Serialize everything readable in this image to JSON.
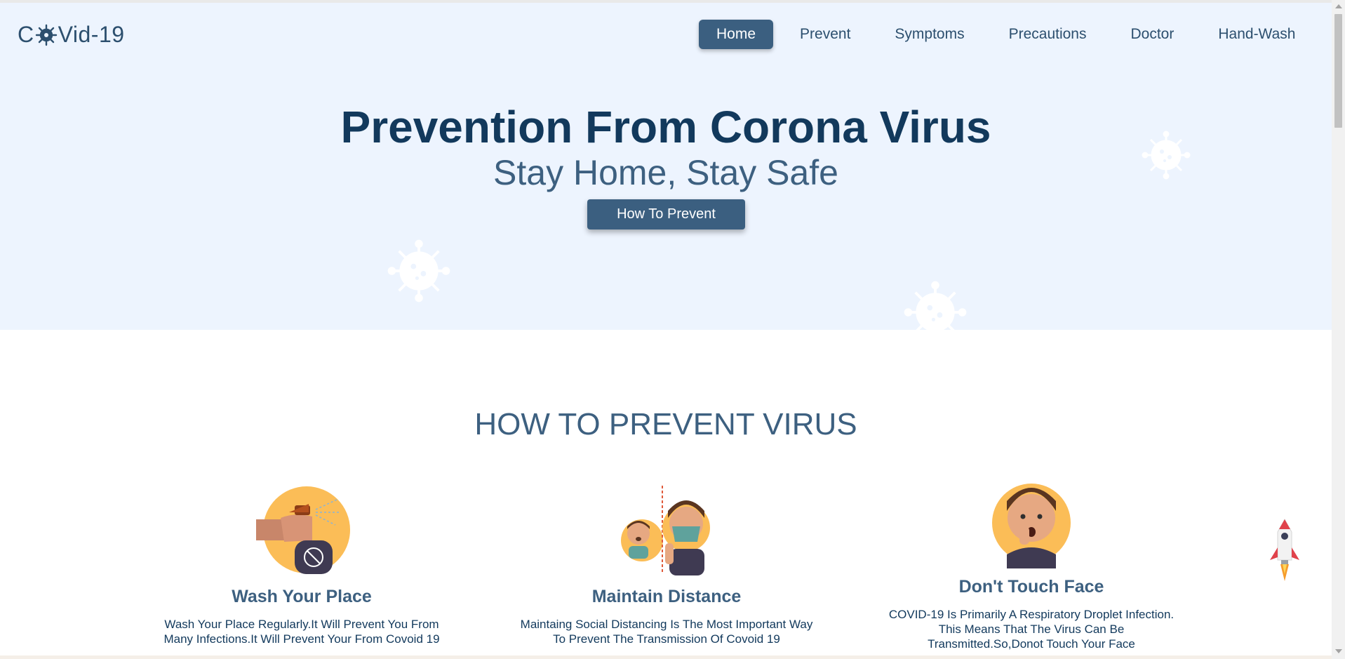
{
  "header": {
    "logo_prefix": "C",
    "logo_suffix": "Vid-19",
    "logo_icon": "virus-gear-icon",
    "nav": [
      {
        "label": "Home",
        "active": true
      },
      {
        "label": "Prevent",
        "active": false
      },
      {
        "label": "Symptoms",
        "active": false
      },
      {
        "label": "Precautions",
        "active": false
      },
      {
        "label": "Doctor",
        "active": false
      },
      {
        "label": "Hand-Wash",
        "active": false
      }
    ]
  },
  "hero": {
    "title": "Prevention From Corona Virus",
    "subtitle": "Stay Home, Stay Safe",
    "button_label": "How To Prevent"
  },
  "section": {
    "title": "HOW TO PREVENT VIRUS",
    "cards": [
      {
        "title": "Wash Your Place",
        "text_line1": "Wash Your Place Regularly.It Will Prevent You From",
        "text_line2": "Many Infections.It Will Prevent Your From Covoid 19",
        "text_line3": "",
        "icon": "spray-bottle-icon"
      },
      {
        "title": "Maintain Distance",
        "text_line1": "Maintaing Social Distancing Is The Most Important Way",
        "text_line2": "To Prevent The Transmission Of Covoid 19",
        "text_line3": "",
        "icon": "social-distance-icon"
      },
      {
        "title": "Don't Touch Face",
        "text_line1": "COVID-19 Is Primarily A Respiratory Droplet Infection.",
        "text_line2": "This Means That The Virus Can Be",
        "text_line3": "Transmitted.So,Donot Touch Your Face",
        "icon": "no-touch-face-icon"
      }
    ]
  },
  "colors": {
    "primary": "#3b5f80",
    "dark": "#12395c",
    "hero_bg": "#edf4fe",
    "accent_yellow": "#fbbd57"
  },
  "scroll_to_top_icon": "rocket-icon"
}
